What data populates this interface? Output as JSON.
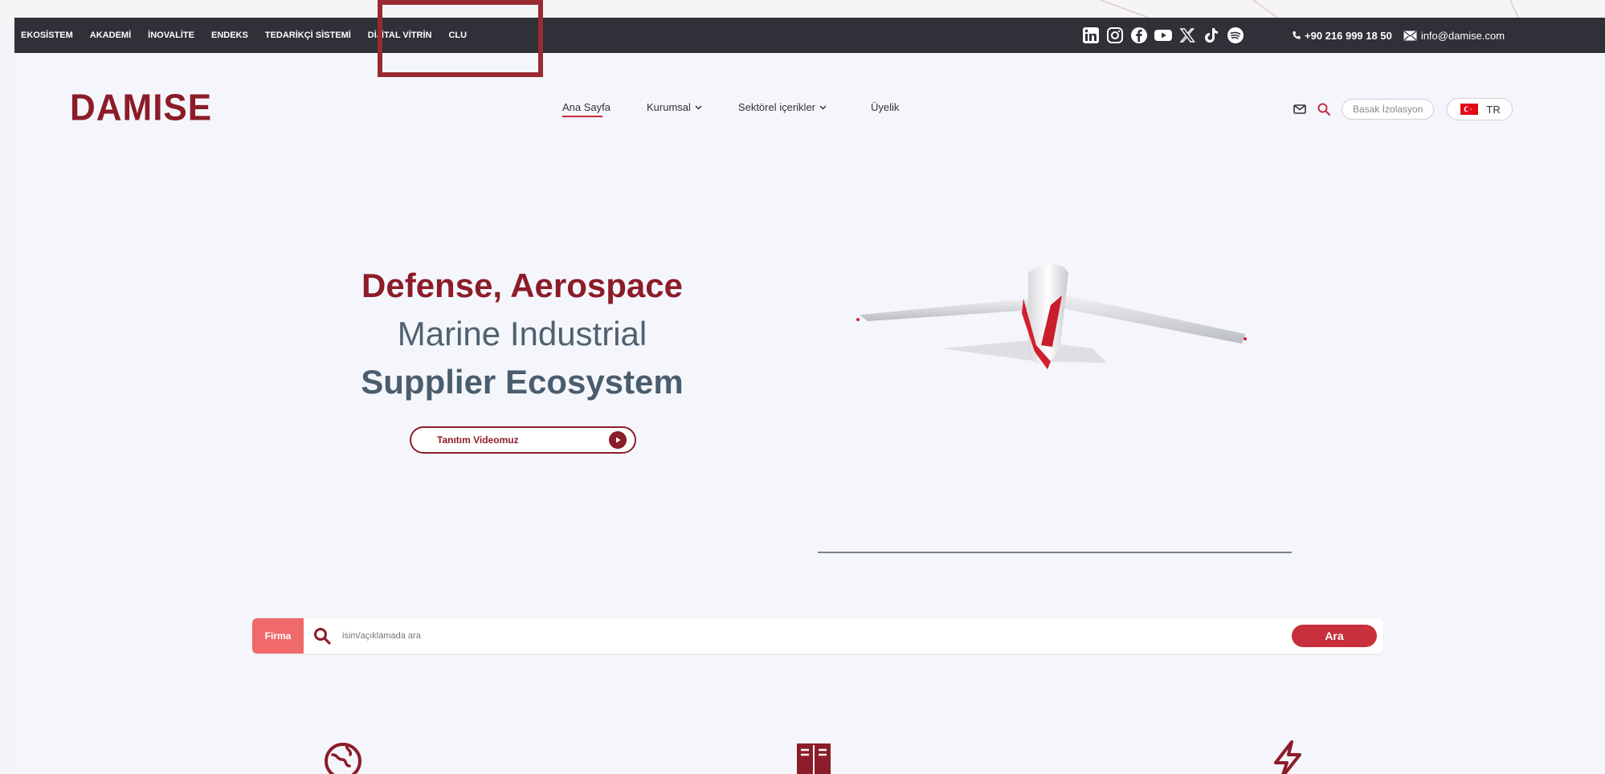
{
  "topbar": {
    "menu": [
      "EKOSİSTEM",
      "AKADEMİ",
      "İNOVALİTE",
      "ENDEKS",
      "TEDARİKÇİ SİSTEMİ",
      "DİJİTAL VİTRİN",
      "CLU"
    ],
    "socials": [
      "linkedin-icon",
      "instagram-icon",
      "facebook-icon",
      "youtube-icon",
      "x-icon",
      "tiktok-icon",
      "spotify-icon"
    ],
    "phone": "+90 216 999 18 50",
    "email": "info@damise.com"
  },
  "header": {
    "logo": "DAMISE",
    "nav": [
      {
        "label": "Ana Sayfa",
        "dropdown": false,
        "active": true
      },
      {
        "label": "Kurumsal",
        "dropdown": true,
        "active": false
      },
      {
        "label": "Sektörel içerikler",
        "dropdown": true,
        "active": false
      },
      {
        "label": "Üyelik",
        "dropdown": false,
        "active": false
      }
    ],
    "pill_label": "Basak İzolasyon",
    "lang": "TR"
  },
  "hero": {
    "line1": "Defense, Aerospace",
    "line2": "Marine Industrial",
    "line3": "Supplier Ecosystem",
    "video_button": "Tanıtım Videomuz"
  },
  "search": {
    "tag": "Firma",
    "placeholder": "isim/açıklamada ara",
    "button": "Ara"
  },
  "colors": {
    "brand": "#8c1c29",
    "accent": "#c7303c",
    "topbar": "#2f3038",
    "tag": "#f0696b"
  }
}
